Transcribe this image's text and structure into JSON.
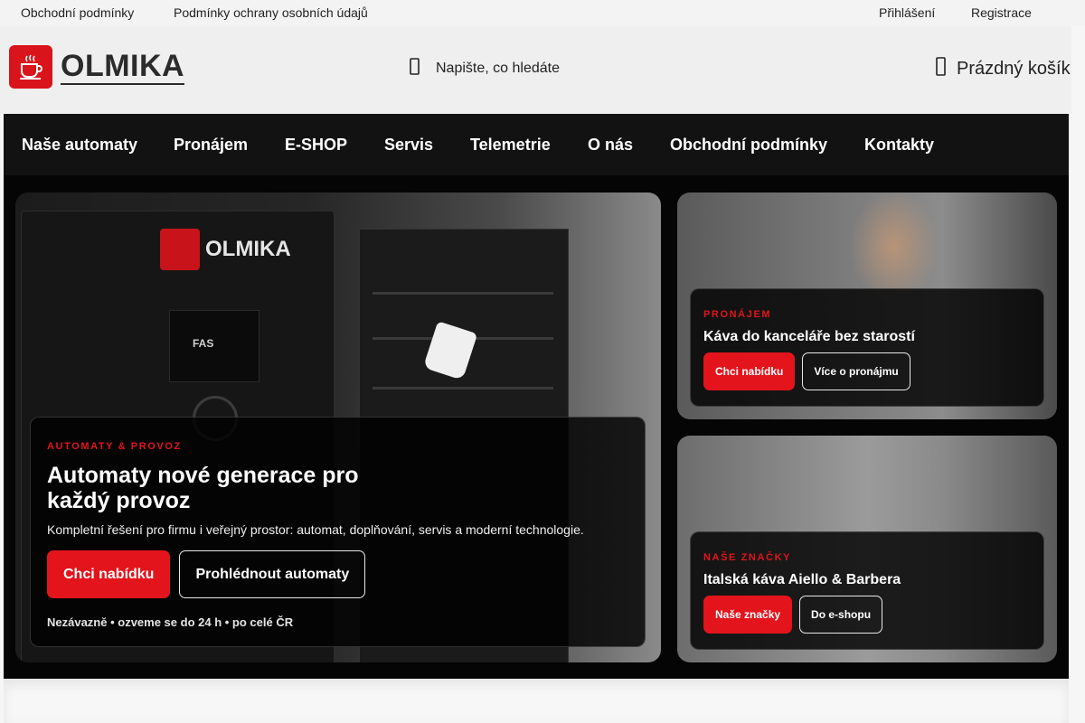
{
  "topbar": {
    "links": [
      "Obchodní podmínky",
      "Podmínky ochrany osobních údajů"
    ],
    "account": {
      "login": "Přihlášení",
      "register": "Registrace"
    }
  },
  "header": {
    "logo_text": "OLMIKA",
    "search_placeholder": "Napište, co hledáte",
    "search_icon": "search-icon",
    "cart_label": "Prázdný košík",
    "cart_icon": "cart-icon"
  },
  "nav": {
    "items": [
      "Naše automaty",
      "Pronájem",
      "E-SHOP",
      "Servis",
      "Telemetrie",
      "O nás",
      "Obchodní podmínky",
      "Kontakty"
    ]
  },
  "hero": {
    "main": {
      "image_text": {
        "machine_brand": "OLMIKA",
        "screen_brand": "FAS"
      },
      "eyebrow": "AUTOMATY & PROVOZ",
      "title": "Automaty nové generace pro každý provoz",
      "description": "Kompletní řešení pro firmu i veřejný prostor: automat, doplňování, servis a moderní technologie.",
      "primary_button": "Chci nabídku",
      "secondary_button": "Prohlédnout automaty",
      "note": "Nezávazně • ozveme se do 24 h • po celé ČR"
    },
    "rent": {
      "eyebrow": "PRONÁJEM",
      "title": "Káva do kanceláře bez starostí",
      "primary_button": "Chci nabídku",
      "secondary_button": "Více o pronájmu"
    },
    "brands": {
      "eyebrow": "NAŠE ZNAČKY",
      "title": "Italská káva Aiello & Barbera",
      "primary_button": "Naše značky",
      "secondary_button": "Do e-shopu"
    }
  },
  "colors": {
    "accent_red": "#e3141c",
    "nav_bg": "#121212",
    "header_bg": "#efefef",
    "topbar_bg": "#f3f3f3"
  }
}
